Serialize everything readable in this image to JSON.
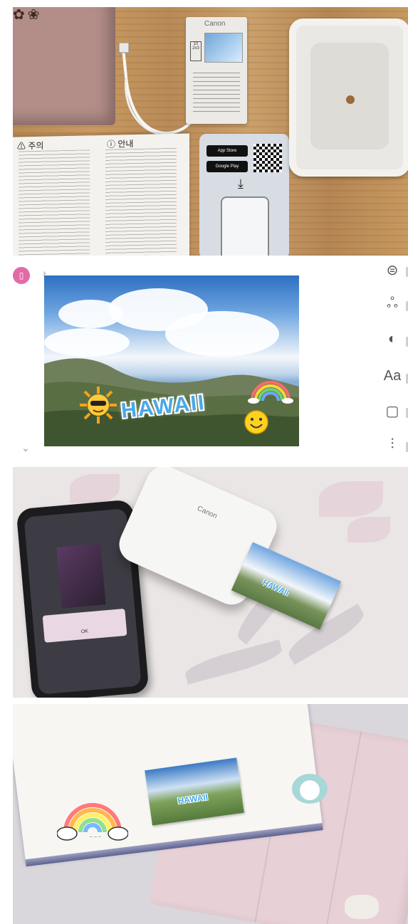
{
  "panel1": {
    "manual_warning_heading": "⚠ 주의",
    "manual_info_heading": "ⓘ 안내",
    "paper_brand": "Canon",
    "paper_size_tag": "10 2x3",
    "app_store_badge": "App Store",
    "google_play_badge": "Google Play"
  },
  "panel2": {
    "photo_caption": "HAWAII",
    "tools": [
      {
        "icon": "print-frame-icon",
        "glyph": "⊜"
      },
      {
        "icon": "filter-icon",
        "glyph": "ஃ"
      },
      {
        "icon": "adjust-icon",
        "glyph": "◐"
      },
      {
        "icon": "text-icon",
        "glyph": "Aa"
      },
      {
        "icon": "border-icon",
        "glyph": "▢"
      },
      {
        "icon": "sliders-icon",
        "glyph": "⫶"
      }
    ]
  },
  "panel3": {
    "printer_logo": "Canon",
    "phone_dialog_button": "OK",
    "print_caption": "HAWAII"
  },
  "panel4": {
    "sticker_caption": "HAWAII"
  },
  "colors": {
    "wood": "#c19260",
    "sky": "#2d6fc2",
    "hawaii_text": "#4aa8e8",
    "avatar": "#e36aa6",
    "tablet_pink": "#e7d1d6"
  }
}
